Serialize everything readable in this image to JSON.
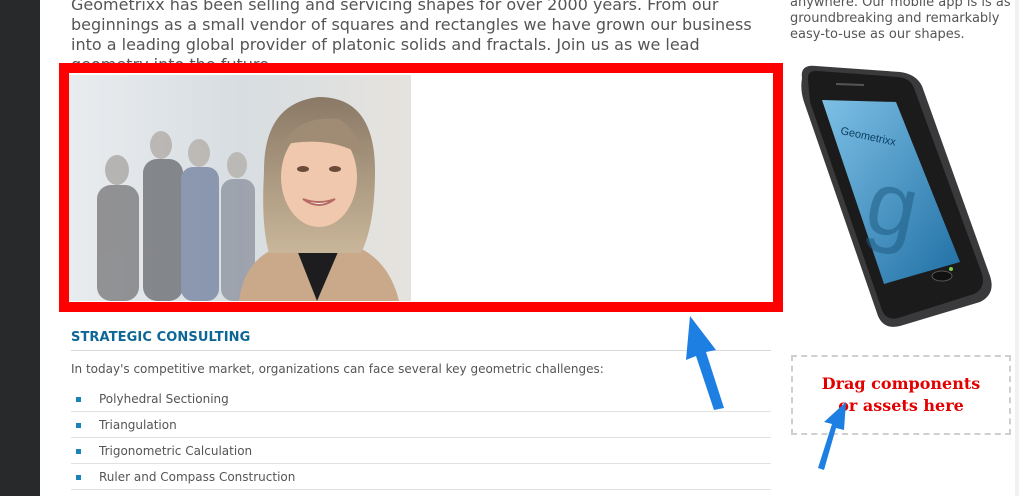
{
  "intro": {
    "text": "Geometrixx has been selling and servicing shapes for over 2000 years. From our beginnings as a small vendor of squares and rectangles we have grown our business into a leading global provider of platonic solids and fractals. Join us as we lead geometry into the future."
  },
  "sidebar": {
    "app_text": "anywhere. Our mobile app is is as groundbreaking and remarkably easy-to-use as our shapes.",
    "phone_brand": "Geometrixx"
  },
  "consulting": {
    "title": "STRATEGIC CONSULTING",
    "intro": "In today's competitive market, organizations can face several key geometric challenges:",
    "items": [
      "Polyhedral Sectioning",
      "Triangulation",
      "Trigonometric Calculation",
      "Ruler and Compass Construction"
    ]
  },
  "drop_zone": {
    "label": "Drag components or assets here"
  },
  "colors": {
    "highlight": "#ff0000",
    "link_blue": "#0c6796",
    "arrow_blue": "#1e7fe3",
    "drop_text": "#e30000"
  }
}
